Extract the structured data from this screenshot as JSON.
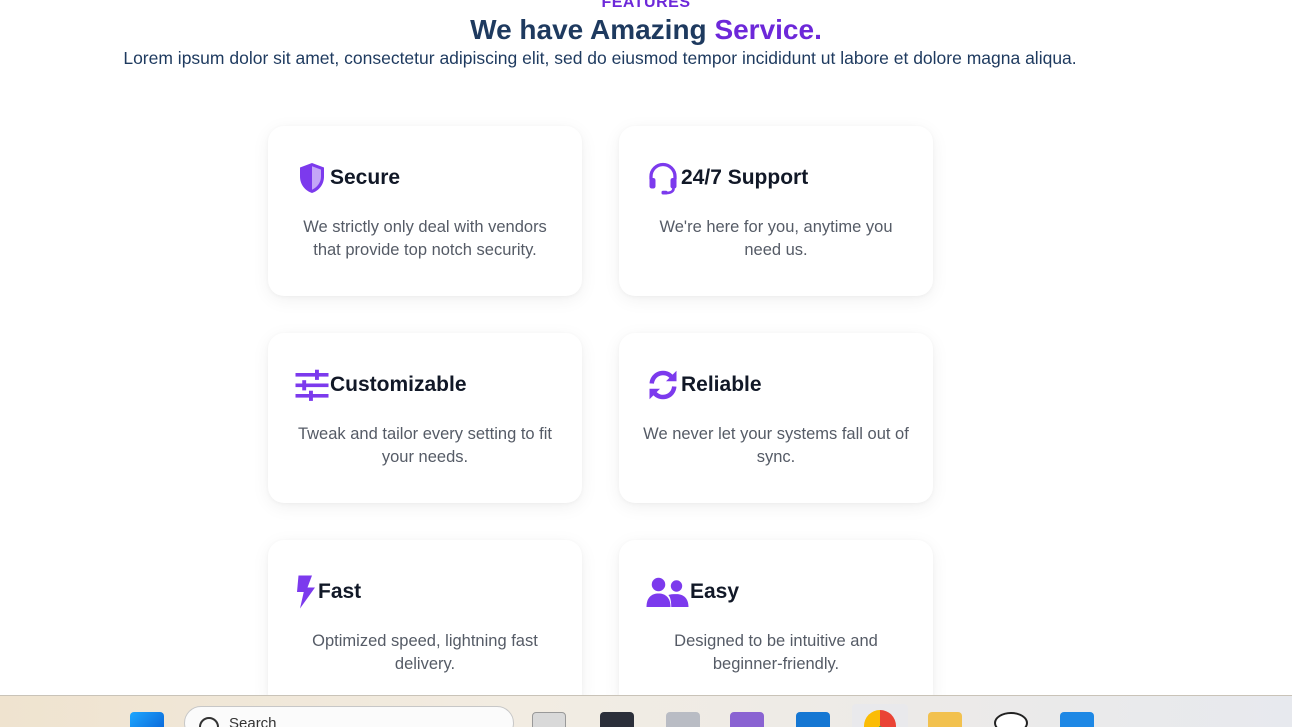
{
  "section": {
    "eyebrow": "FEATURES",
    "headline_main": "We have Amazing",
    "headline_accent": "Service.",
    "lede": "Lorem ipsum dolor sit amet, consectetur adipiscing elit, sed do eiusmod tempor incididunt ut labore et dolore magna aliqua."
  },
  "features": [
    {
      "title": "Secure",
      "icon": "shield-icon",
      "desc": "We strictly only deal with vendors that provide top notch security."
    },
    {
      "title": "24/7 Support",
      "icon": "headset-icon",
      "desc": "We're here for you, anytime you need us."
    },
    {
      "title": "Customizable",
      "icon": "sliders-icon",
      "desc": "Tweak and tailor every setting to fit your needs."
    },
    {
      "title": "Reliable",
      "icon": "sync-icon",
      "desc": "We never let your systems fall out of sync."
    },
    {
      "title": "Fast",
      "icon": "bolt-icon",
      "desc": "Optimized speed, lightning fast delivery."
    },
    {
      "title": "Easy",
      "icon": "users-icon",
      "desc": "Designed to be intuitive and beginner-friendly."
    }
  ],
  "taskbar": {
    "search_label": "Search",
    "apps": [
      "start-icon",
      "taskview-icon",
      "terminal-icon",
      "devtools-icon",
      "visual-studio-icon",
      "outlook-icon",
      "chrome-icon",
      "file-explorer-icon",
      "chatgpt-icon",
      "vscode-icon"
    ]
  },
  "colors": {
    "accent": "#6d28d9",
    "icon": "#7c3aed",
    "heading": "#1e3a5f"
  }
}
